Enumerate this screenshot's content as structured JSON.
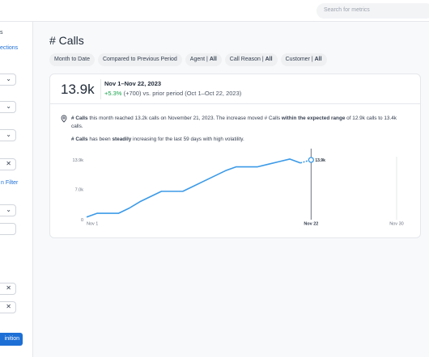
{
  "search": {
    "placeholder": "Search for metrics"
  },
  "sidebar": {
    "texts": [
      "s",
      "ections",
      "n Filter"
    ],
    "selects": [
      "⌄",
      "⌄",
      "⌄",
      "⌄"
    ],
    "clear": [
      "✕",
      "✕",
      "✕"
    ],
    "button": "inition"
  },
  "page": {
    "title": "# Calls"
  },
  "filters": [
    {
      "label": "Month to Date",
      "value": ""
    },
    {
      "label": "Compared to Previous Period",
      "value": ""
    },
    {
      "label": "Agent | ",
      "value": "All"
    },
    {
      "label": "Call Reason | ",
      "value": "All"
    },
    {
      "label": "Customer | ",
      "value": "All"
    }
  ],
  "kpi": {
    "value": "13.9k",
    "period": "Nov 1–Nov 22, 2023",
    "change": "+5.3%",
    "change_rest": " (+700) vs. prior period (Oct 1–Oct 22, 2023)"
  },
  "insight": {
    "a": "# Calls",
    "b": " this month reached 13.2k calls on November 21, 2023. The increase moved # Calls ",
    "c": "within the expected range",
    "d": " of 12.9k calls to 13.4k calls.",
    "e": "# Calls",
    "f": " has been ",
    "g": "steadily",
    "h": " increasing for the last 59 days with high volatility."
  },
  "chart_data": {
    "type": "line",
    "series": [
      {
        "x": [
          1,
          2,
          3,
          4,
          5,
          6,
          7,
          8,
          9,
          10,
          11,
          12,
          13,
          14,
          15,
          16,
          17,
          18,
          19,
          20,
          21
        ],
        "values": [
          0.6,
          1.5,
          1.5,
          1.5,
          2.7,
          4.2,
          5.4,
          6.6,
          6.6,
          6.6,
          7.8,
          9.0,
          10.2,
          11.4,
          12.3,
          12.3,
          12.3,
          12.9,
          13.5,
          14.1,
          13.2
        ]
      }
    ],
    "forecast_x": [
      21,
      22
    ],
    "forecast_values": [
      13.2,
      13.9
    ],
    "highlight": {
      "x": 22,
      "value": 13.9,
      "label": "13.9k"
    },
    "yticks": [
      0,
      7,
      13.9
    ],
    "ytick_labels": [
      "0",
      "7.0k",
      "13.9k"
    ],
    "xticks": [
      1,
      22,
      30
    ],
    "xtick_labels": [
      "Nov 1",
      "Nov 22",
      "Nov 30"
    ],
    "xlim": [
      1,
      30
    ],
    "ylim": [
      0,
      13.9
    ],
    "color": "#3b9ae8",
    "grid": false
  }
}
